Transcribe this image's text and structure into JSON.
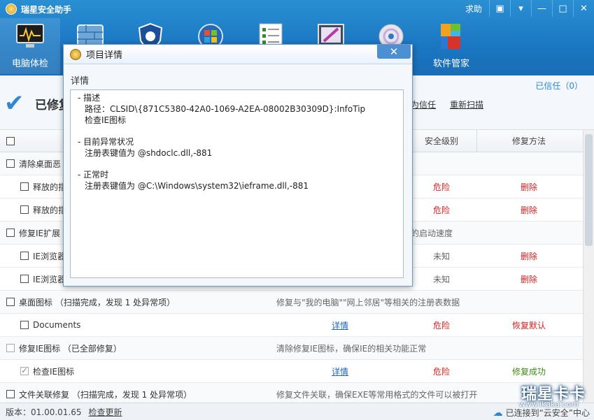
{
  "app": {
    "title": "瑞星安全助手",
    "help": "求助"
  },
  "window_controls": [
    "skin",
    "menu",
    "minimize",
    "maximize",
    "close"
  ],
  "toolbar": [
    {
      "label": "电脑体检",
      "icon": "monitor-icon"
    },
    {
      "label": "",
      "icon": "firewall-icon"
    },
    {
      "label": "",
      "icon": "shield-icon"
    },
    {
      "label": "",
      "icon": "windows-icon"
    },
    {
      "label": "",
      "icon": "checklist-icon"
    },
    {
      "label": "",
      "icon": "paint-icon"
    },
    {
      "label": "",
      "icon": "disc-icon"
    },
    {
      "label": "软件管家",
      "icon": "software-manager-icon"
    }
  ],
  "status": {
    "message": "已修复",
    "trusted": "已信任（0）",
    "trust_link": "为信任",
    "rescan_link": "重新扫描"
  },
  "table": {
    "headers": {
      "level": "安全级别",
      "fix": "修复方法"
    },
    "rows": [
      {
        "type": "group",
        "name": "清除桌面恶",
        "desc": ""
      },
      {
        "type": "item",
        "name": "释放的指",
        "level": "危险",
        "fix": "删除"
      },
      {
        "type": "item",
        "name": "释放的指",
        "level": "危险",
        "fix": "删除"
      },
      {
        "type": "group",
        "name": "修复IE扩展",
        "desc": "的启动速度"
      },
      {
        "type": "item",
        "name": "IE浏览器",
        "level": "未知",
        "fix": "删除"
      },
      {
        "type": "item",
        "name": "IE浏览器",
        "level": "未知",
        "fix": "删除"
      },
      {
        "type": "group",
        "name": "桌面图标 （扫描完成，发现 1 处异常项）",
        "desc": "修复与\"我的电脑\"\"网上邻居\"等相关的注册表数据"
      },
      {
        "type": "item",
        "name": "Documents",
        "detail": "详情",
        "level": "危险",
        "fix": "恢复默认"
      },
      {
        "type": "group",
        "name": "修复IE图标 （已全部修复）",
        "desc": "清除修复IE图标，确保IE的相关功能正常"
      },
      {
        "type": "item",
        "name": "检查IE图标",
        "detail": "详情",
        "level": "危险",
        "fix": "修复成功"
      },
      {
        "type": "group",
        "name": "文件关联修复 （扫描完成，发现 1 处异常项）",
        "desc": "修复文件关联，确保EXE等常用格式的文件可以被打开"
      }
    ]
  },
  "footer": {
    "version": "版本：01.00.01.65",
    "update": "检查更新",
    "cloud": "已连接到“云安全”中心"
  },
  "watermark": {
    "main": "瑞星卡卡",
    "sub": "www.ikaka.com"
  },
  "dialog": {
    "title": "项目详情",
    "subtitle": "详情",
    "close": "✕",
    "sections": [
      {
        "heading": "- 描述",
        "lines": [
          "路径：CLSID\\{871C5380-42A0-1069-A2EA-08002B30309D}:InfoTip",
          "检查IE图标"
        ]
      },
      {
        "heading": "- 目前异常状况",
        "lines": [
          "注册表键值为 @shdoclc.dll,-881"
        ]
      },
      {
        "heading": "- 正常时",
        "lines": [
          "注册表键值为 @C:\\Windows\\system32\\ieframe.dll,-881"
        ]
      }
    ]
  }
}
